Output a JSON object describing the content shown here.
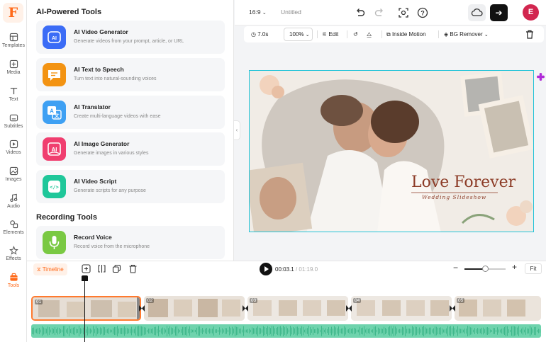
{
  "rail": {
    "logo": "F",
    "items": [
      {
        "label": "Templates",
        "icon": "templates-icon"
      },
      {
        "label": "Media",
        "icon": "media-icon"
      },
      {
        "label": "Text",
        "icon": "text-icon"
      },
      {
        "label": "Subtitles",
        "icon": "subtitles-icon"
      },
      {
        "label": "Videos",
        "icon": "videos-icon"
      },
      {
        "label": "Images",
        "icon": "images-icon"
      },
      {
        "label": "Audio",
        "icon": "audio-icon"
      },
      {
        "label": "Elements",
        "icon": "elements-icon"
      },
      {
        "label": "Effects",
        "icon": "effects-icon"
      },
      {
        "label": "Tools",
        "icon": "tools-icon"
      }
    ],
    "active": "Tools",
    "accent": "#ff6a1a"
  },
  "panel": {
    "ai_section_title": "AI-Powered Tools",
    "ai_tools": [
      {
        "title": "AI Video Generator",
        "desc": "Generate videos from your prompt, article, or URL",
        "color": "#3b6cf6"
      },
      {
        "title": "AI Text to Speech",
        "desc": "Turn text into natural-sounding voices",
        "color": "#f39312"
      },
      {
        "title": "AI Translator",
        "desc": "Create multi-language videos with ease",
        "color": "#3ea0f3"
      },
      {
        "title": "AI Image Generator",
        "desc": "Generate images in various styles",
        "color": "#f03e6f"
      },
      {
        "title": "AI Video Script",
        "desc": "Generate scripts for any purpose",
        "color": "#1fc79a"
      }
    ],
    "recording_section_title": "Recording Tools",
    "recording_tools": [
      {
        "title": "Record Voice",
        "desc": "Record voice from the microphone",
        "color": "#7ac943"
      }
    ]
  },
  "topbar": {
    "aspect_ratio": "16:9",
    "project_name": "Untitled",
    "avatar_initial": "E",
    "avatar_color": "#d2264f"
  },
  "props": {
    "duration": "7.0s",
    "zoom": "100%",
    "edit": "Edit",
    "inside_motion": "Inside Motion",
    "bg_remover": "BG Remover"
  },
  "canvas": {
    "title": "Love Forever",
    "subtitle": "Wedding Slideshow"
  },
  "timeline": {
    "tab": "Timeline",
    "current": "00:03.1",
    "separator": "/",
    "total": "01:19.0",
    "zoom_level": 0.5,
    "fit": "Fit",
    "clips": [
      {
        "num": "01",
        "selected": true
      },
      {
        "num": "02",
        "selected": false
      },
      {
        "num": "03",
        "selected": false
      },
      {
        "num": "04",
        "selected": false
      },
      {
        "num": "05",
        "selected": false
      }
    ]
  }
}
